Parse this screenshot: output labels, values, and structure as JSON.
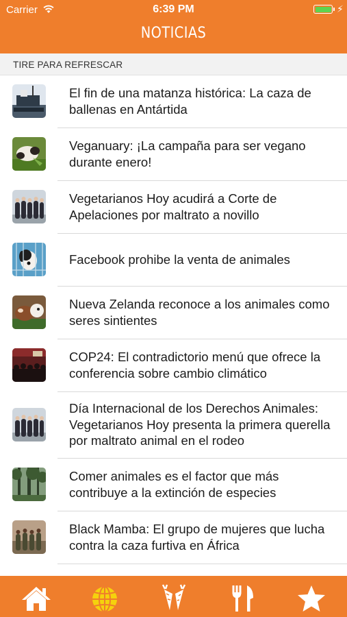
{
  "status_bar": {
    "carrier": "Carrier",
    "time": "6:39 PM",
    "battery_level": 1.0
  },
  "header": {
    "title": "NOTICIAS"
  },
  "refresh_hint": "TIRE PARA REFRESCAR",
  "news": [
    {
      "title": "El fin de una matanza histórica: La caza de ballenas en Antártida",
      "thumb": "whaling-ship"
    },
    {
      "title": "Veganuary: ¡La campaña para ser vegano durante enero!",
      "thumb": "cow-eating-grass"
    },
    {
      "title": "Vegetarianos Hoy acudirá a Corte de Apelaciones por maltrato a novillo",
      "thumb": "group-photo"
    },
    {
      "title": "Facebook prohibe la venta de animales",
      "thumb": "dog-in-cage"
    },
    {
      "title": "Nueva Zelanda reconoce a los animales como seres sintientes",
      "thumb": "cows"
    },
    {
      "title": "COP24: El contradictorio menú que ofrece la conferencia sobre cambio climático",
      "thumb": "conference-hall"
    },
    {
      "title": "Día Internacional de los Derechos Animales: Vegetarianos Hoy presenta la primera querella por maltrato animal en el rodeo",
      "thumb": "group-photo"
    },
    {
      "title": "Comer animales es el factor que más contribuye a la extinción de especies",
      "thumb": "forest"
    },
    {
      "title": "Black Mamba: El grupo de mujeres que lucha contra la caza furtiva en África",
      "thumb": "women-rangers"
    }
  ],
  "tabs": [
    {
      "icon": "home-icon",
      "active": false
    },
    {
      "icon": "globe-icon",
      "active": true
    },
    {
      "icon": "carrots-icon",
      "active": false
    },
    {
      "icon": "fork-knife-icon",
      "active": false
    },
    {
      "icon": "star-icon",
      "active": false
    }
  ],
  "colors": {
    "primary": "#ef7e2c",
    "active_tab": "#f5d20d",
    "tab_icon": "#ffffff",
    "refresh_bg": "#f2f2f2"
  }
}
